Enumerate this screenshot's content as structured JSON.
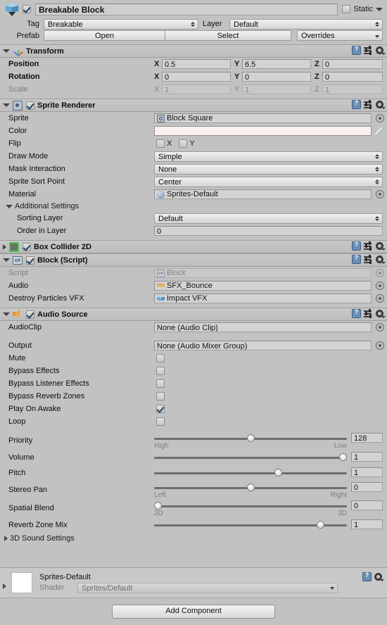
{
  "object_header": {
    "icon": "gameobject-cube-icon",
    "enabled": true,
    "name": "Breakable Block",
    "static_label": "Static",
    "static_checked": false,
    "tag_label": "Tag",
    "tag_value": "Breakable",
    "layer_label": "Layer",
    "layer_value": "Default",
    "prefab_label": "Prefab",
    "prefab_open": "Open",
    "prefab_select": "Select",
    "prefab_overrides": "Overrides"
  },
  "transform": {
    "title": "Transform",
    "rows": [
      {
        "label": "Position",
        "x": "0.5",
        "y": "6.5",
        "z": "0",
        "dim": false
      },
      {
        "label": "Rotation",
        "x": "0",
        "y": "0",
        "z": "0",
        "dim": false
      },
      {
        "label": "Scale",
        "x": "1",
        "y": "1",
        "z": "1",
        "dim": true
      }
    ],
    "axis_x": "X",
    "axis_y": "Y",
    "axis_z": "Z"
  },
  "sprite_renderer": {
    "title": "Sprite Renderer",
    "enabled": true,
    "sprite_label": "Sprite",
    "sprite_value": "Block Square",
    "color_label": "Color",
    "color_value": "#FAF0EF",
    "flip_label": "Flip",
    "flip_x_label": "X",
    "flip_y_label": "Y",
    "flip_x": false,
    "flip_y": false,
    "draw_mode_label": "Draw Mode",
    "draw_mode_value": "Simple",
    "mask_interaction_label": "Mask Interaction",
    "mask_interaction_value": "None",
    "sort_point_label": "Sprite Sort Point",
    "sort_point_value": "Center",
    "material_label": "Material",
    "material_value": "Sprites-Default",
    "additional_settings_label": "Additional Settings",
    "sorting_layer_label": "Sorting Layer",
    "sorting_layer_value": "Default",
    "order_in_layer_label": "Order in Layer",
    "order_in_layer_value": "0"
  },
  "box_collider_2d": {
    "title": "Box Collider 2D",
    "enabled": true,
    "expanded": false
  },
  "block_script": {
    "title": "Block (Script)",
    "enabled": true,
    "script_label": "Script",
    "script_value": "Block",
    "audio_label": "Audio",
    "audio_value": "SFX_Bounce",
    "vfx_label": "Destroy Particles VFX",
    "vfx_value": "Impact VFX"
  },
  "audio_source": {
    "title": "Audio Source",
    "enabled": true,
    "audioclip_label": "AudioClip",
    "audioclip_value": "None (Audio Clip)",
    "output_label": "Output",
    "output_value": "None (Audio Mixer Group)",
    "toggles": [
      {
        "label": "Mute",
        "checked": false
      },
      {
        "label": "Bypass Effects",
        "checked": false
      },
      {
        "label": "Bypass Listener Effects",
        "checked": false
      },
      {
        "label": "Bypass Reverb Zones",
        "checked": false
      },
      {
        "label": "Play On Awake",
        "checked": true
      },
      {
        "label": "Loop",
        "checked": false
      }
    ],
    "sliders": [
      {
        "label": "Priority",
        "value": "128",
        "pct": 50,
        "left_label": "High",
        "right_label": "Low"
      },
      {
        "label": "Volume",
        "value": "1",
        "pct": 100,
        "left_label": "",
        "right_label": ""
      },
      {
        "label": "Pitch",
        "value": "1",
        "pct": 65,
        "left_label": "",
        "right_label": ""
      },
      {
        "label": "Stereo Pan",
        "value": "0",
        "pct": 50,
        "left_label": "Left",
        "right_label": "Right"
      },
      {
        "label": "Spatial Blend",
        "value": "0",
        "pct": 0,
        "left_label": "2D",
        "right_label": "3D"
      },
      {
        "label": "Reverb Zone Mix",
        "value": "1",
        "pct": 88,
        "left_label": "",
        "right_label": ""
      }
    ],
    "sound_settings_3d_label": "3D Sound Settings"
  },
  "material_footer": {
    "name": "Sprites-Default",
    "shader_label": "Shader",
    "shader_value": "Sprites/Default"
  },
  "footer": {
    "add_component_label": "Add Component"
  }
}
